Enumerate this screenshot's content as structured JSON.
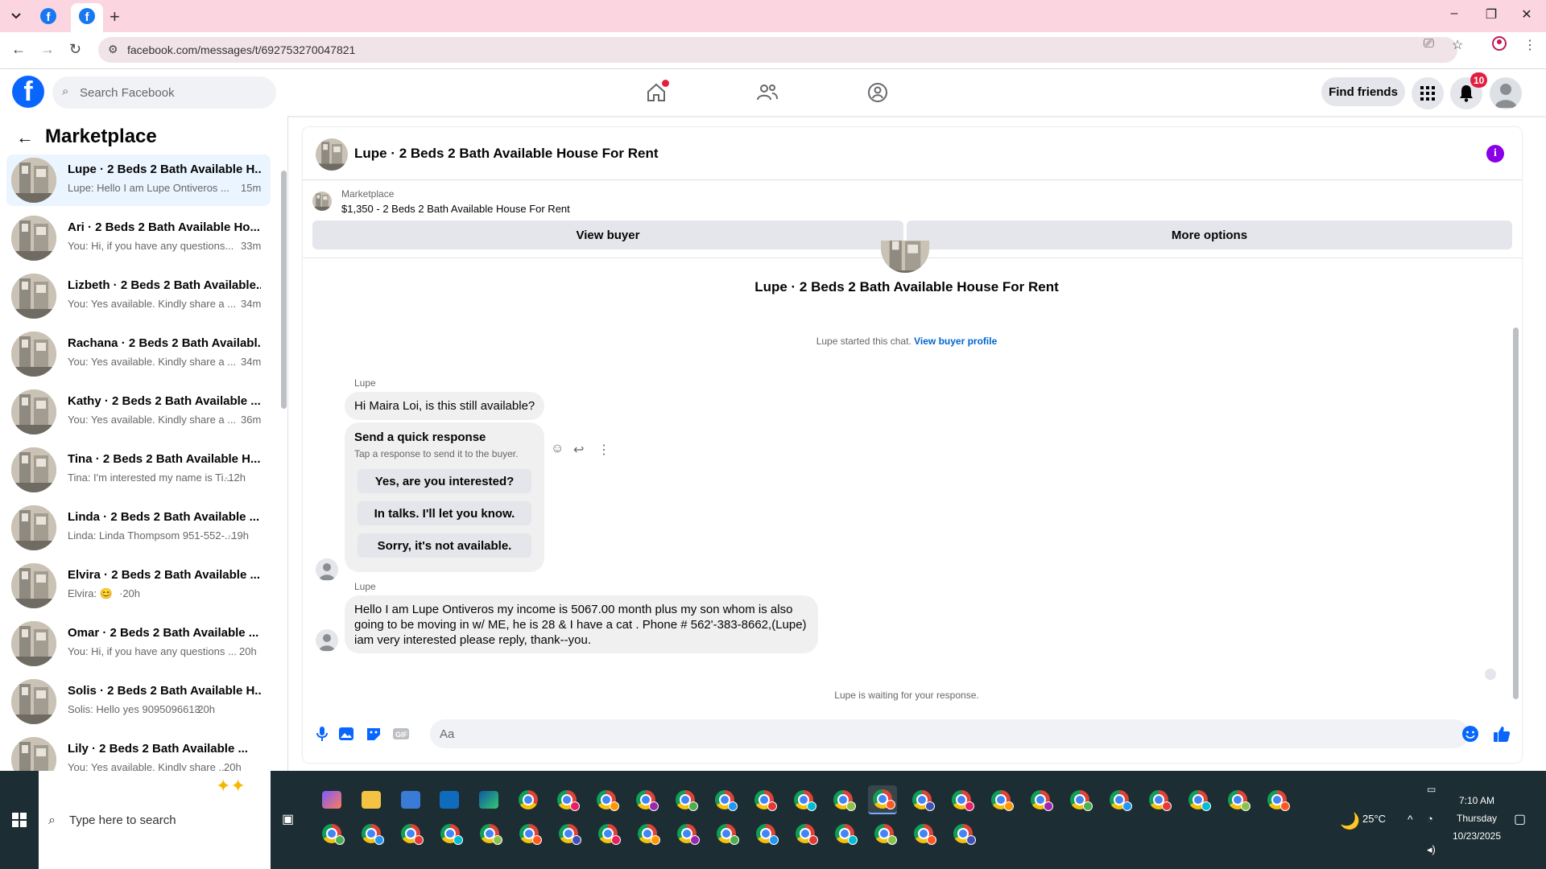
{
  "browser": {
    "url": "facebook.com/messages/t/692753270047821",
    "new_tab": "+",
    "window": {
      "minimize": "–",
      "restore": "❐",
      "close": "✕"
    }
  },
  "header": {
    "search_placeholder": "Search Facebook",
    "find_friends": "Find friends",
    "notification_count": "10"
  },
  "sidebar": {
    "title": "Marketplace",
    "conversations": [
      {
        "title": "Lupe · 2 Beds 2 Bath Available H...",
        "preview": "Lupe: Hello I am Lupe Ontiveros ...",
        "time": "15m"
      },
      {
        "title": "Ari · 2 Beds 2 Bath Available Ho...",
        "preview": "You: Hi, if you have any questions...",
        "time": "33m"
      },
      {
        "title": "Lizbeth · 2 Beds 2 Bath Available...",
        "preview": "You: Yes available. Kindly share a ...",
        "time": "34m"
      },
      {
        "title": "Rachana · 2 Beds 2 Bath Availabl...",
        "preview": "You: Yes available. Kindly share a ...",
        "time": "34m"
      },
      {
        "title": "Kathy · 2 Beds 2 Bath Available ...",
        "preview": "You: Yes available. Kindly share a ...",
        "time": "36m"
      },
      {
        "title": "Tina · 2 Beds 2 Bath Available H...",
        "preview": "Tina: I'm interested my name is Ti...",
        "time": "·12h"
      },
      {
        "title": "Linda · 2 Beds 2 Bath Available ...",
        "preview": "Linda: Linda Thompsom 951-552-...",
        "time": "·19h"
      },
      {
        "title": "Elvira · 2 Beds 2 Bath Available ...",
        "preview": "Elvira: 😊",
        "time": "·20h"
      },
      {
        "title": "Omar · 2 Beds 2 Bath Available ...",
        "preview": "You: Hi, if you have any questions ...",
        "time": "20h"
      },
      {
        "title": "Solis · 2 Beds 2 Bath Available H...",
        "preview": "Solis: Hello yes 9095096613",
        "time": "·20h"
      },
      {
        "title": "Lily · 2 Beds 2 Bath Available ...",
        "preview": "You: Yes available. Kindly share ...",
        "time": "20h"
      }
    ]
  },
  "chat": {
    "title": "Lupe · 2 Beds 2 Bath Available House For Rent",
    "marketplace_label": "Marketplace",
    "listing": "$1,350 - 2 Beds 2 Bath Available House For Rent",
    "view_buyer": "View buyer",
    "more_options": "More options",
    "conversation_name": "Lupe · 2 Beds 2 Bath Available House For Rent",
    "started_text": "Lupe started this chat.",
    "view_buyer_profile": "View buyer profile",
    "sender": "Lupe",
    "message1": "Hi Maira Loi, is this still available?",
    "quick_title": "Send a quick response",
    "quick_sub": "Tap a response to send it to the buyer.",
    "quick_responses": [
      "Yes, are you interested?",
      "In talks. I'll let you know.",
      "Sorry, it's not available."
    ],
    "message2_lines": [
      "Hello I am Lupe  Ontiveros my income is 5067.00 month plus my son whom is also",
      "going to be moving in w/ ME, he is 28 & I have a cat . Phone # 562'-383-8662,(Lupe)",
      "iam very interested please reply, thank--you."
    ],
    "waiting": "Lupe is waiting for your response.",
    "composer_placeholder": "Aa"
  },
  "taskbar": {
    "search_placeholder": "Type here to search",
    "weather": "25°C",
    "time": "7:10 AM",
    "day": "Thursday",
    "date": "10/23/2025"
  },
  "colors": {
    "fb_blue": "#0866ff",
    "messenger_purple": "#8a00e6",
    "tab_pink": "#fbd5df",
    "taskbar": "#1c2d33"
  }
}
